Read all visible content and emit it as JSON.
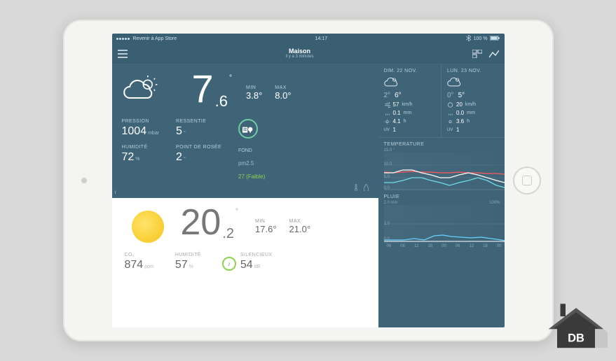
{
  "status": {
    "back_text": "Revenir à App Store",
    "time": "14:17",
    "bt": true,
    "battery": "100 %"
  },
  "header": {
    "title": "Maison",
    "subtitle": "il y a 3 minutes"
  },
  "outdoor": {
    "temp_whole": "7",
    "temp_frac": ".6",
    "temp_unit": "°",
    "min_label": "MIN",
    "min_val": "3.8°",
    "max_label": "MAX",
    "max_val": "8.0°",
    "pression_label": "PRESSION",
    "pression_val": "1004",
    "pression_unit": "mbar",
    "humidite_label": "HUMIDITÉ",
    "humidite_val": "72",
    "humidite_unit": "%",
    "ressentie_label": "RESSENTIE",
    "ressentie_val": "5",
    "ressentie_unit": "°",
    "rosee_label": "POINT DE ROSÉE",
    "rosee_val": "2",
    "rosee_unit": "°",
    "fond_label": "FOND",
    "fond_pm": "pm2.5",
    "fond_status": "27 (Faible)"
  },
  "indoor": {
    "temp_whole": "20",
    "temp_frac": ".2",
    "temp_unit": "°",
    "min_label": "MIN",
    "min_val": "17.6°",
    "max_label": "MAX",
    "max_val": "21.0°",
    "co2_label": "CO₂",
    "co2_val": "874",
    "co2_unit": "ppm",
    "humidite_label": "HUMIDITÉ",
    "humidite_val": "57",
    "humidite_unit": "%",
    "silencieux_label": "SILENCIEUX",
    "silencieux_val": "54",
    "silencieux_unit": "dB"
  },
  "forecast": {
    "day1": {
      "date": "DIM. 22 NOV.",
      "lo": "2°",
      "hi": "6°",
      "wind": "57",
      "wind_unit": "km/h",
      "rain": "0.1",
      "rain_unit": "mm",
      "sun": "4.1",
      "sun_unit": "h",
      "uv": "1"
    },
    "day2": {
      "date": "LUN. 23 NOV.",
      "lo": "0°",
      "hi": "5°",
      "wind": "20",
      "wind_unit": "km/h",
      "rain": "0.0",
      "rain_unit": "mm",
      "sun": "3.6",
      "sun_unit": "h",
      "uv": "1"
    },
    "uv_label": "UV"
  },
  "charts": {
    "temp_title": "TEMPERATURE",
    "temp_max_label": "15.0 °",
    "temp_mid_label": "10.0",
    "temp_low_label": "5.0",
    "temp_zero_label": "0.0",
    "pluie_title": "PLUIE",
    "pluie_left": "2.0 mm",
    "pluie_right": "100%",
    "pluie_mid": "1.0",
    "pluie_zero": "0.0",
    "hours": [
      "06",
      "06",
      "12",
      "18",
      "00",
      "06",
      "12",
      "18",
      "00"
    ]
  },
  "chart_data": [
    {
      "type": "line",
      "title": "TEMPERATURE",
      "ylabel": "°",
      "ylim": [
        0,
        15
      ],
      "x": [
        6,
        9,
        12,
        15,
        18,
        21,
        24,
        27,
        30,
        33,
        36,
        39,
        42,
        45,
        48
      ],
      "series": [
        {
          "name": "indoor",
          "color": "#ff5a5a",
          "values": [
            7.2,
            7.0,
            7.1,
            7.3,
            7.2,
            7.2,
            7.0,
            7.0,
            7.1,
            7.0,
            6.9,
            6.8,
            6.7,
            6.6,
            6.5
          ]
        },
        {
          "name": "outdoor_high",
          "color": "#ffffff",
          "values": [
            7,
            7,
            8,
            8,
            7,
            6,
            5,
            5,
            6,
            7,
            6,
            5,
            4,
            4,
            3
          ]
        },
        {
          "name": "outdoor_low",
          "color": "#6fdce8",
          "values": [
            3,
            3,
            4,
            5,
            5,
            4,
            3,
            2,
            3,
            4,
            5,
            4,
            3,
            2,
            1
          ]
        }
      ]
    },
    {
      "type": "line",
      "title": "PLUIE",
      "ylabel": "mm",
      "ylim": [
        0,
        2
      ],
      "x": [
        6,
        9,
        12,
        15,
        18,
        21,
        24,
        27,
        30,
        33,
        36,
        39,
        42,
        45,
        48
      ],
      "series": [
        {
          "name": "rain_mm",
          "color": "#66d1ff",
          "values": [
            0.1,
            0.1,
            0.1,
            0.15,
            0.1,
            0.25,
            0.28,
            0.22,
            0.2,
            0.18,
            0.2,
            0.15,
            0.1,
            0.1,
            0.05
          ]
        },
        {
          "name": "rain_pct",
          "color": "#ffffff",
          "values": [
            0,
            0,
            0,
            0,
            0,
            0,
            0,
            0,
            0,
            0,
            0,
            0,
            0,
            0,
            0
          ]
        }
      ]
    }
  ]
}
